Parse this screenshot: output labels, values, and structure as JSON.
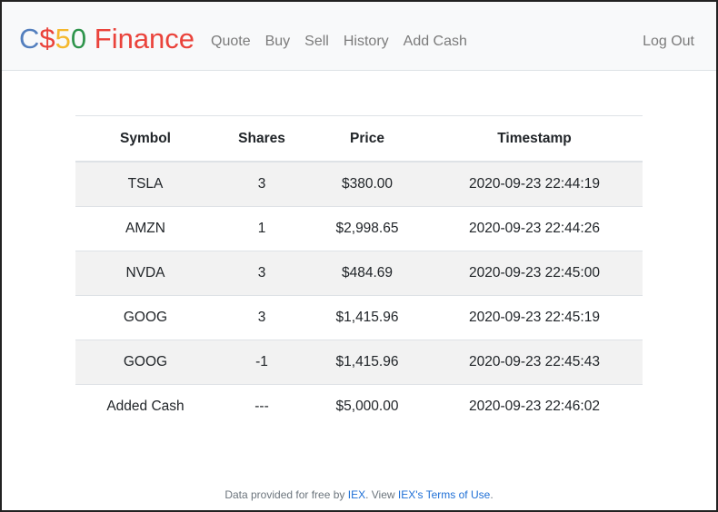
{
  "brand": {
    "parts": [
      {
        "text": "C",
        "color": "#537fbe"
      },
      {
        "text": "$",
        "color": "#ea433b"
      },
      {
        "text": "5",
        "color": "#f5b82e"
      },
      {
        "text": "0",
        "color": "#2e944b"
      },
      {
        "text": " Finance",
        "color": "#ea433b"
      }
    ]
  },
  "nav": {
    "links": [
      "Quote",
      "Buy",
      "Sell",
      "History",
      "Add Cash"
    ],
    "logout": "Log Out"
  },
  "table": {
    "headers": [
      "Symbol",
      "Shares",
      "Price",
      "Timestamp"
    ],
    "rows": [
      [
        "TSLA",
        "3",
        "$380.00",
        "2020-09-23 22:44:19"
      ],
      [
        "AMZN",
        "1",
        "$2,998.65",
        "2020-09-23 22:44:26"
      ],
      [
        "NVDA",
        "3",
        "$484.69",
        "2020-09-23 22:45:00"
      ],
      [
        "GOOG",
        "3",
        "$1,415.96",
        "2020-09-23 22:45:19"
      ],
      [
        "GOOG",
        "-1",
        "$1,415.96",
        "2020-09-23 22:45:43"
      ],
      [
        "Added Cash",
        "---",
        "$5,000.00",
        "2020-09-23 22:46:02"
      ]
    ]
  },
  "footer": {
    "prefix": "Data provided for free by ",
    "iex_link": "IEX",
    "middle": ". View ",
    "terms_link": "IEX's Terms of Use",
    "suffix": "."
  }
}
